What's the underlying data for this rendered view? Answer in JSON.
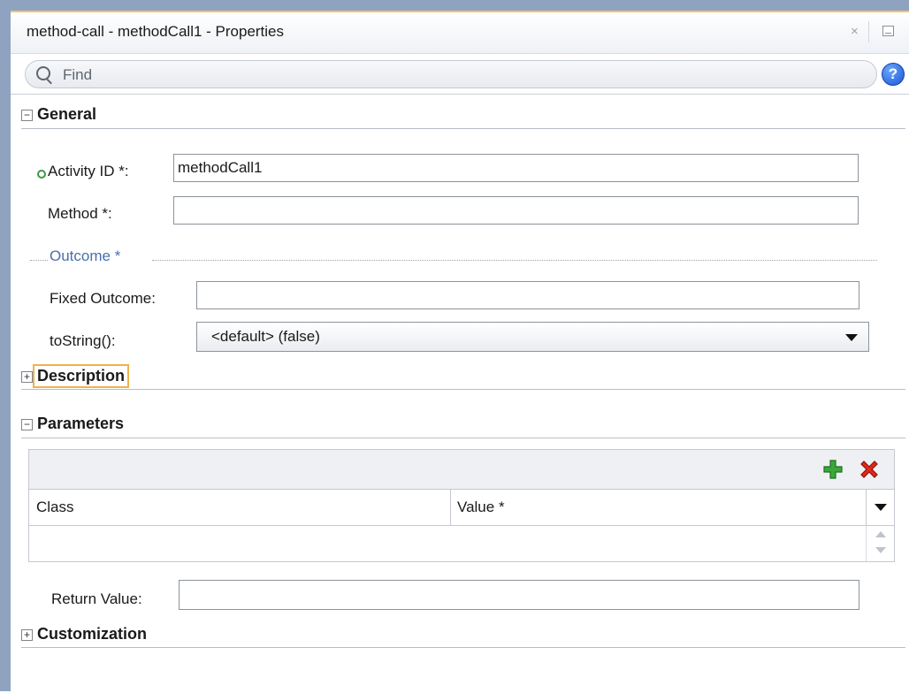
{
  "window": {
    "title": "method-call - methodCall1 - Properties",
    "close_glyph": "×"
  },
  "search": {
    "placeholder": "Find"
  },
  "help": {
    "glyph": "?"
  },
  "sections": {
    "general": {
      "title": "General",
      "toggle": "−"
    },
    "description": {
      "title": "Description",
      "toggle": "+"
    },
    "parameters": {
      "title": "Parameters",
      "toggle": "−"
    },
    "customization": {
      "title": "Customization",
      "toggle": "+"
    }
  },
  "general": {
    "activity_id": {
      "label": "Activity ID *:",
      "value": "methodCall1"
    },
    "method": {
      "label": "Method *:",
      "value": ""
    },
    "outcome_group": "Outcome *",
    "fixed_outcome": {
      "label": "Fixed Outcome:",
      "value": ""
    },
    "to_string": {
      "label": "toString():",
      "value": "<default> (false)"
    }
  },
  "parameters": {
    "columns": [
      "Class",
      "Value *"
    ],
    "rows": [],
    "return_value": {
      "label": "Return Value:",
      "value": ""
    }
  },
  "colors": {
    "accent_border": "#f3c56a",
    "frame": "#8fa3c0",
    "add_green": "#3aa83a",
    "delete_red": "#e02a1a",
    "status_green": "#3c9a3c"
  }
}
